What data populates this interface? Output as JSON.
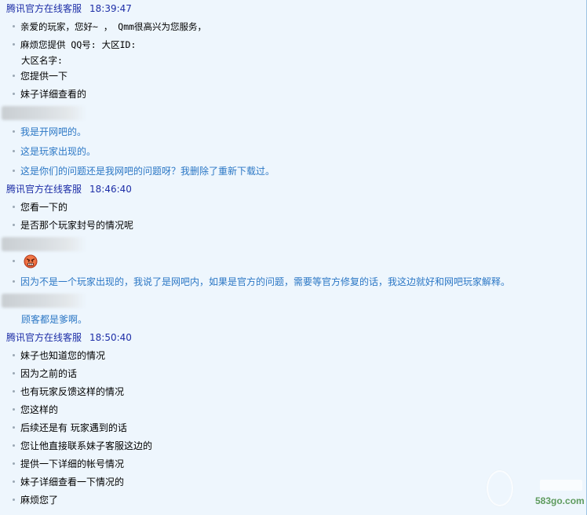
{
  "window": {
    "title": ""
  },
  "agent_name": "腾讯官方在线客服",
  "conversation": [
    {
      "type": "agent",
      "time": "18:39:47",
      "lines": [
        {
          "text": "亲爱的玩家，您好~ ， Qmm很高兴为您服务，",
          "mono": true
        },
        {
          "text": "麻烦您提供 QQ号:  大区ID:",
          "mono": true
        },
        {
          "text": "大区名字:",
          "mono": true,
          "continuation": true
        },
        {
          "text": "您提供一下"
        },
        {
          "text": "妹子详细查看的"
        }
      ]
    },
    {
      "type": "user",
      "lines": [
        {
          "text": "我是开网吧的。"
        },
        {
          "text": "这是玩家出现的。"
        },
        {
          "text": "这是你们的问题还是我网吧的问题呀？我删除了重新下载过。"
        }
      ]
    },
    {
      "type": "agent",
      "time": "18:46:40",
      "lines": [
        {
          "text": "您看一下的"
        },
        {
          "text": "是否那个玩家封号的情况呢"
        }
      ]
    },
    {
      "type": "user",
      "lines": [
        {
          "text": "",
          "emoji": "angry-face"
        },
        {
          "text": "因为不是一个玩家出现的，我说了是网吧内，如果是官方的问题，需要等官方修复的话，我这边就好和网吧玩家解释。"
        },
        {
          "text": "顾客都是爹啊。",
          "continuation": true
        }
      ]
    },
    {
      "type": "agent",
      "time": "18:50:40",
      "lines": [
        {
          "text": "妹子也知道您的情况"
        },
        {
          "text": "因为之前的话"
        },
        {
          "text": "也有玩家反馈这样的情况"
        },
        {
          "text": "您这样的"
        },
        {
          "text": "后续还是有 玩家遇到的话"
        },
        {
          "text": "您让他直接联系妹子客服这边的"
        },
        {
          "text": "提供一下详细的帐号情况"
        },
        {
          "text": "妹子详细查看一下情况的"
        },
        {
          "text": "麻烦您了"
        }
      ]
    }
  ],
  "colors": {
    "agent_header": "#1d2ea7",
    "user_text": "#2b77c5",
    "agent_text": "#000000",
    "background": "#eef6fd"
  },
  "watermark": {
    "site": "583go.com"
  }
}
